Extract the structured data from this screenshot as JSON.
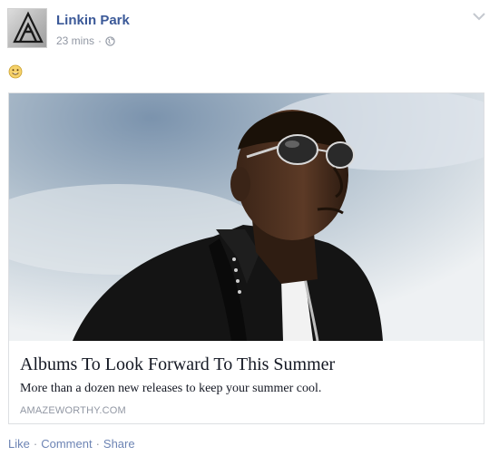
{
  "post": {
    "page_name": "Linkin Park",
    "timestamp": "23 mins",
    "separator": "·",
    "emoji": "smiling-face",
    "avatar_icon": "linkin-park-logo-icon",
    "privacy_icon": "globe-icon",
    "options_icon": "chevron-down-icon"
  },
  "link": {
    "title": "Albums To Look Forward To This Summer",
    "description": "More than a dozen new releases to keep your summer cool.",
    "domain": "AMAZEWORTHY.COM"
  },
  "actions": {
    "like": "Like",
    "comment": "Comment",
    "share": "Share",
    "separator": "·"
  },
  "colors": {
    "name_blue": "#3b5998",
    "action_blue": "#6d84b4",
    "meta_gray": "#9197a3",
    "border": "#dddfe2"
  }
}
